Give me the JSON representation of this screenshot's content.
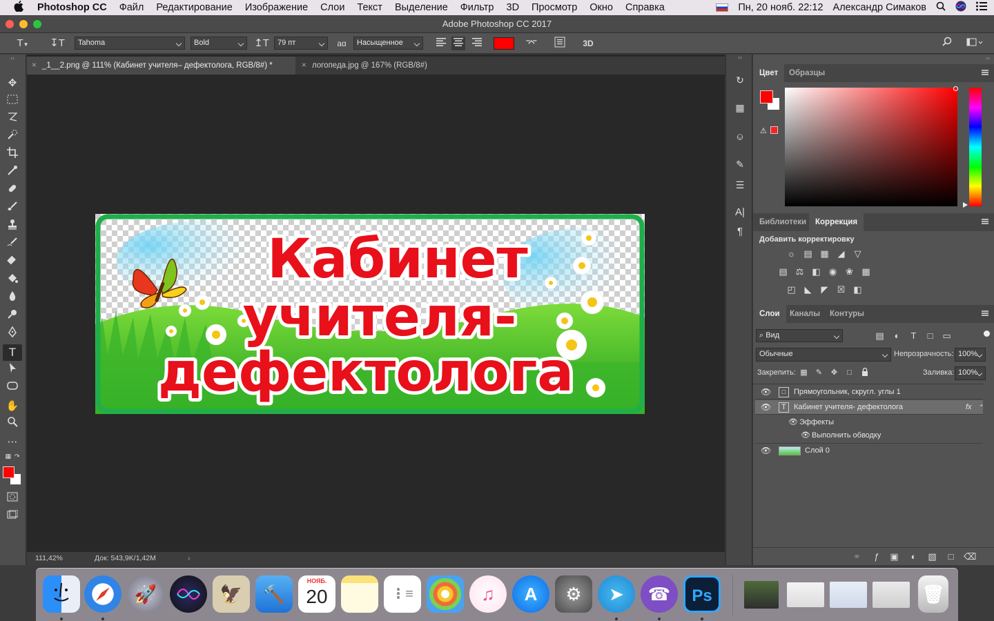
{
  "menubar": {
    "app_name": "Photoshop CC",
    "items": [
      "Файл",
      "Редактирование",
      "Изображение",
      "Слои",
      "Текст",
      "Выделение",
      "Фильтр",
      "3D",
      "Просмотр",
      "Окно",
      "Справка"
    ],
    "datetime": "Пн, 20 нояб.  22:12",
    "user": "Александр Симаков"
  },
  "window": {
    "title": "Adobe Photoshop CC 2017"
  },
  "options": {
    "font_family": "Tahoma",
    "font_style": "Bold",
    "font_size": "79 пт",
    "antialias": "Насыщенное",
    "aa_glyph": "aɑ",
    "text_color": "#ff0000",
    "three_d": "3D"
  },
  "document": {
    "tabs": [
      {
        "label": "_1__2.png @ 111% (Кабинет учителя– дефектолога, RGB/8#) *",
        "active": true
      },
      {
        "label": "логопеда.jpg @ 167% (RGB/8#)",
        "active": false
      }
    ],
    "banner_lines": [
      "Кабинет",
      "учителя-",
      "дефектолога"
    ],
    "zoom": "111,42%",
    "doc_size": "Док: 543,9K/1,42M"
  },
  "color_panel": {
    "tabs": [
      "Цвет",
      "Образцы"
    ],
    "foreground": "#ff0000",
    "background": "#ffffff"
  },
  "adjust_panel": {
    "tabs": [
      "Библиотеки",
      "Коррекция"
    ],
    "heading": "Добавить корректировку"
  },
  "layers_panel": {
    "tabs": [
      "Слои",
      "Каналы",
      "Контуры"
    ],
    "filter": "Вид",
    "blend_mode": "Обычные",
    "opacity_label": "Непрозрачность:",
    "opacity": "100%",
    "lock_label": "Закрепить:",
    "fill_label": "Заливка:",
    "fill": "100%",
    "layers": [
      {
        "name": "Прямоугольник, скругл. углы 1"
      },
      {
        "name": "Кабинет учителя- дефектолога",
        "fx": "fx"
      },
      {
        "name": "Эффекты"
      },
      {
        "name": "Выполнить обводку"
      },
      {
        "name": "Слой 0"
      }
    ]
  },
  "dock": {
    "calendar_month": "НОЯБ.",
    "calendar_day": "20",
    "ps_label": "Ps"
  }
}
